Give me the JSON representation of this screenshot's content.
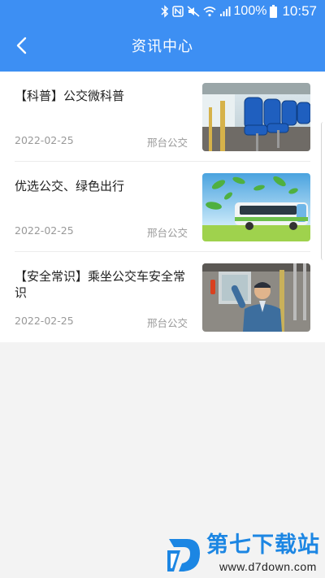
{
  "status_bar": {
    "battery_percent": "100%",
    "time": "10:57",
    "icons": [
      "bluetooth-icon",
      "nfc-icon",
      "mute-icon",
      "wifi-icon",
      "signal-icon",
      "battery-icon"
    ]
  },
  "header": {
    "title": "资讯中心",
    "back_icon": "chevron-left-icon",
    "background_color": "#3d8ff3"
  },
  "news": [
    {
      "title": "【科普】公交微科普",
      "date": "2022-02-25",
      "source": "邢台公交",
      "image": "bus-seats-photo"
    },
    {
      "title": "优选公交、绿色出行",
      "date": "2022-02-25",
      "source": "邢台公交",
      "image": "green-bus-photo"
    },
    {
      "title": "【安全常识】乘坐公交车安全常识",
      "date": "2022-02-25",
      "source": "邢台公交",
      "image": "bus-driver-photo"
    }
  ],
  "watermark": {
    "name": "第七下载站",
    "url": "www.d7down.com",
    "color": "#1c86e3"
  }
}
